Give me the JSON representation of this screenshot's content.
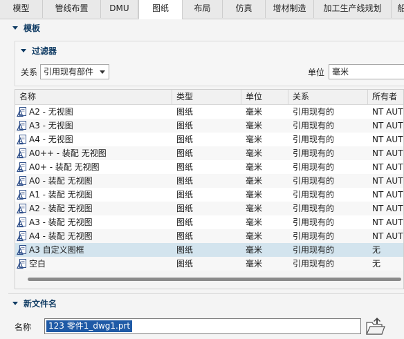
{
  "tabs": [
    {
      "label": "模型",
      "active": false
    },
    {
      "label": "管线布置",
      "active": false
    },
    {
      "label": "DMU",
      "active": false
    },
    {
      "label": "图纸",
      "active": true
    },
    {
      "label": "布局",
      "active": false
    },
    {
      "label": "仿真",
      "active": false
    },
    {
      "label": "增材制造",
      "active": false
    },
    {
      "label": "加工生产线规划",
      "active": false
    },
    {
      "label": "船",
      "active": false
    }
  ],
  "template_section": {
    "title": "模板"
  },
  "filter_section": {
    "title": "过滤器",
    "relation_label": "关系",
    "relation_value": "引用现有部件",
    "unit_label": "单位",
    "unit_value": "毫米"
  },
  "table": {
    "columns": [
      "名称",
      "类型",
      "单位",
      "关系",
      "所有者"
    ],
    "rows": [
      {
        "name": "A2 - 无视图",
        "type": "图纸",
        "unit": "毫米",
        "relation": "引用现有的",
        "owner": "NT AUTH"
      },
      {
        "name": "A3 - 无视图",
        "type": "图纸",
        "unit": "毫米",
        "relation": "引用现有的",
        "owner": "NT AUTH"
      },
      {
        "name": "A4 - 无视图",
        "type": "图纸",
        "unit": "毫米",
        "relation": "引用现有的",
        "owner": "NT AUTH"
      },
      {
        "name": "A0++ - 装配 无视图",
        "type": "图纸",
        "unit": "毫米",
        "relation": "引用现有的",
        "owner": "NT AUTH"
      },
      {
        "name": "A0+ - 装配 无视图",
        "type": "图纸",
        "unit": "毫米",
        "relation": "引用现有的",
        "owner": "NT AUTH"
      },
      {
        "name": "A0 - 装配 无视图",
        "type": "图纸",
        "unit": "毫米",
        "relation": "引用现有的",
        "owner": "NT AUTH"
      },
      {
        "name": "A1 - 装配 无视图",
        "type": "图纸",
        "unit": "毫米",
        "relation": "引用现有的",
        "owner": "NT AUTH"
      },
      {
        "name": "A2 - 装配 无视图",
        "type": "图纸",
        "unit": "毫米",
        "relation": "引用现有的",
        "owner": "NT AUTH"
      },
      {
        "name": "A3 - 装配 无视图",
        "type": "图纸",
        "unit": "毫米",
        "relation": "引用现有的",
        "owner": "NT AUTH"
      },
      {
        "name": "A4 - 装配 无视图",
        "type": "图纸",
        "unit": "毫米",
        "relation": "引用现有的",
        "owner": "NT AUTH"
      },
      {
        "name": "A3 自定义图框",
        "type": "图纸",
        "unit": "毫米",
        "relation": "引用现有的",
        "owner": "无",
        "selected": true
      },
      {
        "name": "空白",
        "type": "图纸",
        "unit": "毫米",
        "relation": "引用现有的",
        "owner": "无"
      }
    ]
  },
  "new_file_section": {
    "title": "新文件名",
    "name_label": "名称",
    "name_value": "123 零件1_dwg1.prt"
  },
  "icons": {
    "template_row": "drawing-template-icon",
    "browse": "open-folder-icon"
  },
  "colors": {
    "section_title": "#0f3b63",
    "selected_row": "#d3e4ee",
    "text_selection": "#1f5aa6"
  }
}
